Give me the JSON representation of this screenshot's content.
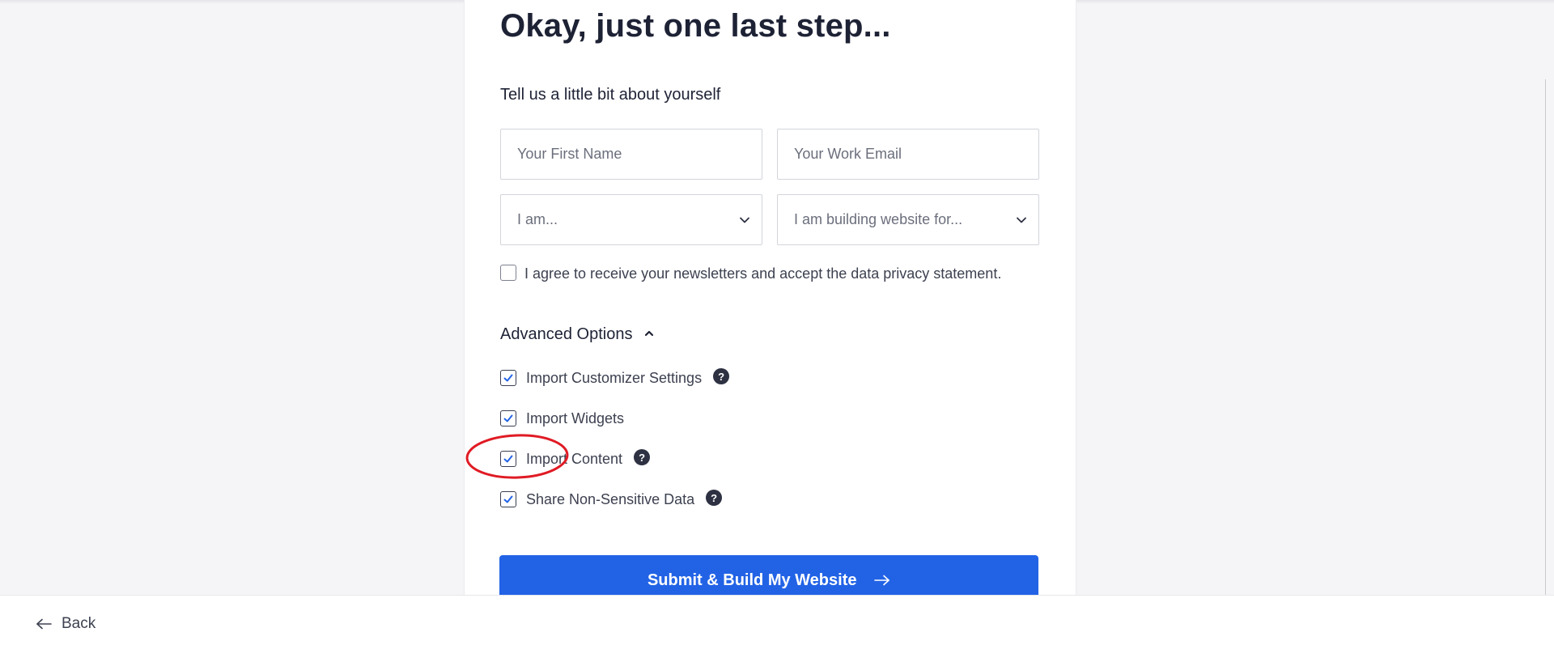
{
  "page": {
    "title": "Okay, just one last step...",
    "subtitle": "Tell us a little bit about yourself"
  },
  "form": {
    "first_name_placeholder": "Your First Name",
    "email_placeholder": "Your Work Email",
    "role_select_value": "I am...",
    "purpose_select_value": "I am building website for...",
    "newsletter_label": "I agree to receive your newsletters and accept the data privacy statement.",
    "newsletter_checked": false
  },
  "advanced": {
    "label": "Advanced Options",
    "expanded": true,
    "options": [
      {
        "label": "Import Customizer Settings",
        "checked": true,
        "has_help": true
      },
      {
        "label": "Import Widgets",
        "checked": true,
        "has_help": false
      },
      {
        "label": "Import Content",
        "checked": true,
        "has_help": true
      },
      {
        "label": "Share Non-Sensitive Data",
        "checked": true,
        "has_help": true
      }
    ]
  },
  "help_symbol": "?",
  "submit_label": "Submit & Build My Website",
  "footer": {
    "back_label": "Back"
  },
  "colors": {
    "primary": "#2263e6",
    "annotation": "#e01b24",
    "text": "#1e2235"
  }
}
